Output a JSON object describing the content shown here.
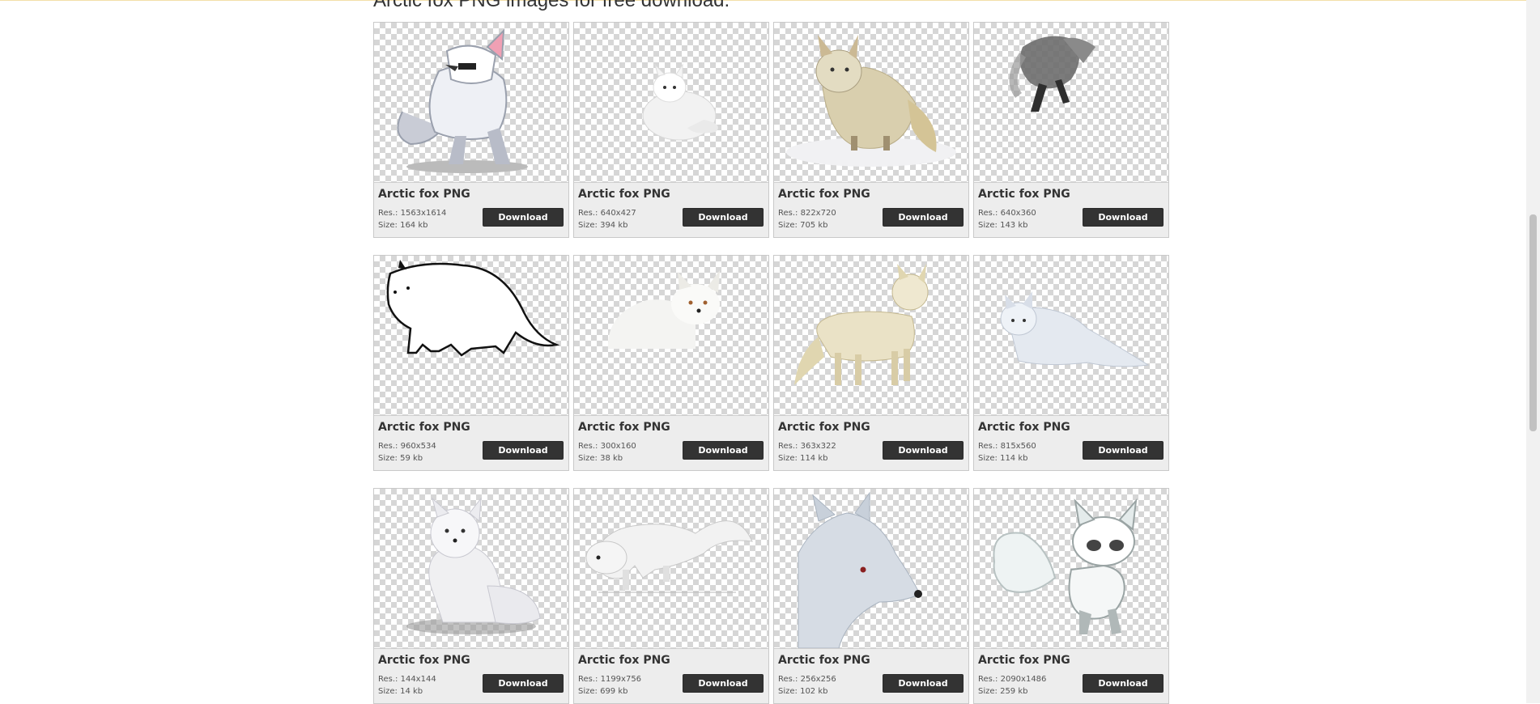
{
  "page": {
    "heading": "Arctic fox PNG images for free download."
  },
  "items": [
    {
      "title": "Arctic fox PNG",
      "res": "Res.: 1563x1614",
      "size": "Size: 164 kb",
      "button": "Download",
      "image": "cartoon-arctic-fox-sunglasses"
    },
    {
      "title": "Arctic fox PNG",
      "res": "Res.: 640x427",
      "size": "Size: 394 kb",
      "button": "Download",
      "image": "white-fox-sitting"
    },
    {
      "title": "Arctic fox PNG",
      "res": "Res.: 822x720",
      "size": "Size: 705 kb",
      "button": "Download",
      "image": "tan-fox-in-snow"
    },
    {
      "title": "Arctic fox PNG",
      "res": "Res.: 640x360",
      "size": "Size: 143 kb",
      "button": "Download",
      "image": "grey-fox-leaping"
    },
    {
      "title": "Arctic fox PNG",
      "res": "Res.: 960x534",
      "size": "Size: 59 kb",
      "button": "Download",
      "image": "fox-outline-drawing"
    },
    {
      "title": "Arctic fox PNG",
      "res": "Res.: 300x160",
      "size": "Size: 38 kb",
      "button": "Download",
      "image": "white-fox-lying"
    },
    {
      "title": "Arctic fox PNG",
      "res": "Res.: 363x322",
      "size": "Size: 114 kb",
      "button": "Download",
      "image": "cream-fox-standing"
    },
    {
      "title": "Arctic fox PNG",
      "res": "Res.: 815x560",
      "size": "Size: 114 kb",
      "button": "Download",
      "image": "pale-fox-crouching"
    },
    {
      "title": "Arctic fox PNG",
      "res": "Res.: 144x144",
      "size": "Size: 14 kb",
      "button": "Download",
      "image": "white-fox-sitting-front"
    },
    {
      "title": "Arctic fox PNG",
      "res": "Res.: 1199x756",
      "size": "Size: 699 kb",
      "button": "Download",
      "image": "white-fox-prowling"
    },
    {
      "title": "Arctic fox PNG",
      "res": "Res.: 256x256",
      "size": "Size: 102 kb",
      "button": "Download",
      "image": "fox-head-portrait"
    },
    {
      "title": "Arctic fox PNG",
      "res": "Res.: 2090x1486",
      "size": "Size: 259 kb",
      "button": "Download",
      "image": "cartoon-fox-sitting"
    }
  ],
  "colors": {
    "button_bg": "#333333",
    "card_bg": "#ededed",
    "heading": "#333333"
  }
}
